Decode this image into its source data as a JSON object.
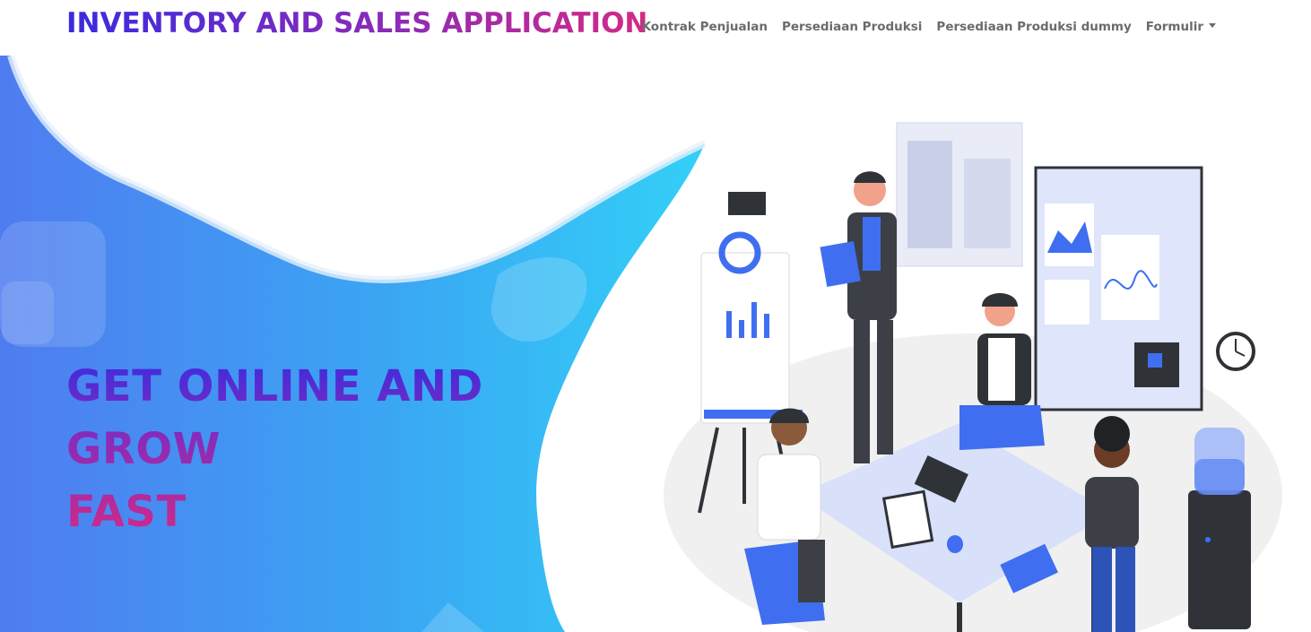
{
  "brand": {
    "title": "INVENTORY AND SALES APPLICATION"
  },
  "nav": {
    "items": [
      {
        "label": "Kontrak Penjualan"
      },
      {
        "label": "Persediaan Produksi"
      },
      {
        "label": "Persediaan Produksi dummy"
      },
      {
        "label": "Formulir"
      }
    ]
  },
  "hero": {
    "headline_line1": "GET ONLINE AND GROW",
    "headline_line2": "FAST"
  },
  "colors": {
    "brand_gradient_start": "#3a2be0",
    "brand_gradient_end": "#d42a86",
    "blob_start": "#4f7cf0",
    "blob_end": "#33d0f7",
    "accent_blue": "#3f6ff0"
  }
}
